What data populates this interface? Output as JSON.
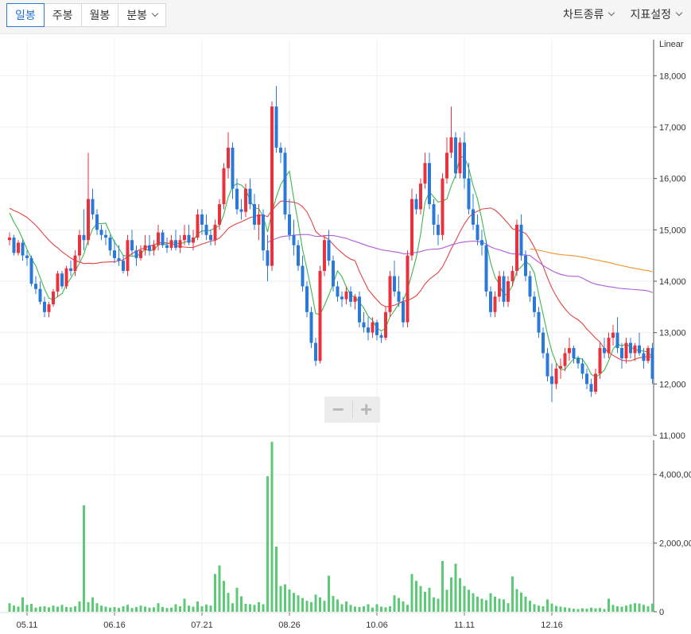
{
  "toolbar": {
    "periods": [
      {
        "label": "일봉",
        "active": true
      },
      {
        "label": "주봉",
        "active": false
      },
      {
        "label": "월봉",
        "active": false
      },
      {
        "label": "분봉",
        "active": false
      }
    ],
    "chart_type_label": "차트종류",
    "indicator_label": "지표설정"
  },
  "zoom": {
    "out_glyph": "−",
    "in_glyph": "+"
  },
  "chart_data": {
    "type": "candlestick",
    "scale_label": "Linear",
    "x_ticks": [
      "05.11",
      "06.16",
      "07.21",
      "08.26",
      "10.06",
      "11.11",
      "12.16"
    ],
    "price_axis": {
      "min": 11000,
      "max": 18700,
      "ticks": [
        11000,
        12000,
        13000,
        14000,
        15000,
        16000,
        17000,
        18000
      ],
      "tick_labels": [
        "11,000",
        "12,000",
        "13,000",
        "14,000",
        "15,000",
        "16,000",
        "17,000",
        "18,000"
      ]
    },
    "volume_axis": {
      "min": 0,
      "max": 5000000,
      "ticks": [
        0,
        2000000,
        4000000
      ],
      "tick_labels": [
        "0",
        "2,000,00",
        "4,000,00"
      ]
    },
    "colors": {
      "up": "#e8333f",
      "down": "#2a78d8",
      "volume": "#5cc977",
      "ma5": "#3db84f",
      "ma20": "#e04545",
      "ma60": "#b35ad9",
      "ma120": "#f0932b"
    },
    "candles": [
      [
        14800,
        14950,
        14700,
        14850
      ],
      [
        14850,
        14900,
        14500,
        14550
      ],
      [
        14550,
        14800,
        14500,
        14750
      ],
      [
        14750,
        14800,
        14400,
        14500
      ],
      [
        14500,
        14600,
        14300,
        14450
      ],
      [
        14450,
        14500,
        13900,
        13950
      ],
      [
        13950,
        14100,
        13750,
        13850
      ],
      [
        13850,
        14000,
        13550,
        13600
      ],
      [
        13600,
        13700,
        13300,
        13400
      ],
      [
        13400,
        13600,
        13300,
        13550
      ],
      [
        13550,
        13850,
        13500,
        13800
      ],
      [
        13800,
        14200,
        13700,
        14150
      ],
      [
        14150,
        14200,
        13850,
        13900
      ],
      [
        13900,
        14300,
        13850,
        14250
      ],
      [
        14250,
        14400,
        14100,
        14200
      ],
      [
        14200,
        14600,
        14100,
        14500
      ],
      [
        14500,
        15000,
        14400,
        14900
      ],
      [
        14900,
        15400,
        14600,
        14800
      ],
      [
        14800,
        16500,
        14700,
        15600
      ],
      [
        15600,
        15800,
        15200,
        15300
      ],
      [
        15300,
        15400,
        14900,
        15000
      ],
      [
        15000,
        15100,
        14800,
        14900
      ],
      [
        14900,
        15000,
        14700,
        14850
      ],
      [
        14850,
        14900,
        14500,
        14600
      ],
      [
        14600,
        14800,
        14350,
        14450
      ],
      [
        14450,
        14700,
        14300,
        14400
      ],
      [
        14400,
        14500,
        14150,
        14200
      ],
      [
        14200,
        14900,
        14100,
        14800
      ],
      [
        14800,
        15000,
        14500,
        14600
      ],
      [
        14600,
        14700,
        14300,
        14450
      ],
      [
        14450,
        14700,
        14400,
        14600
      ],
      [
        14600,
        14900,
        14500,
        14700
      ],
      [
        14700,
        14900,
        14500,
        14600
      ],
      [
        14600,
        14800,
        14500,
        14700
      ],
      [
        14700,
        15100,
        14600,
        14950
      ],
      [
        14950,
        15000,
        14650,
        14700
      ],
      [
        14700,
        14850,
        14550,
        14650
      ],
      [
        14650,
        14900,
        14600,
        14800
      ],
      [
        14800,
        15000,
        14600,
        14650
      ],
      [
        14650,
        14900,
        14550,
        14800
      ],
      [
        14800,
        15100,
        14700,
        14900
      ],
      [
        14900,
        15100,
        14700,
        14750
      ],
      [
        14750,
        15000,
        14600,
        14850
      ],
      [
        14850,
        15400,
        14800,
        15300
      ],
      [
        15300,
        15400,
        14900,
        15100
      ],
      [
        15100,
        15300,
        14800,
        14900
      ],
      [
        14900,
        15000,
        14700,
        14800
      ],
      [
        14800,
        15200,
        14700,
        15100
      ],
      [
        15100,
        15600,
        15000,
        15500
      ],
      [
        15500,
        16300,
        15400,
        16200
      ],
      [
        16200,
        16900,
        16000,
        16600
      ],
      [
        16600,
        16700,
        15600,
        15800
      ],
      [
        15800,
        16000,
        15300,
        15400
      ],
      [
        15400,
        15600,
        15200,
        15350
      ],
      [
        15350,
        15900,
        15250,
        15800
      ],
      [
        15800,
        16000,
        15400,
        15500
      ],
      [
        15500,
        15700,
        15000,
        15100
      ],
      [
        15100,
        15500,
        14800,
        15300
      ],
      [
        15300,
        15400,
        14400,
        14600
      ],
      [
        14600,
        14900,
        14000,
        14300
      ],
      [
        14300,
        17500,
        14200,
        17400
      ],
      [
        17400,
        17800,
        16500,
        16600
      ],
      [
        16600,
        16700,
        16300,
        16500
      ],
      [
        16500,
        16600,
        15200,
        15300
      ],
      [
        15300,
        15600,
        14800,
        14900
      ],
      [
        14900,
        15200,
        14500,
        14700
      ],
      [
        14700,
        14800,
        14200,
        14300
      ],
      [
        14300,
        14500,
        13800,
        13900
      ],
      [
        13900,
        14000,
        13300,
        13400
      ],
      [
        13400,
        13500,
        12700,
        12800
      ],
      [
        12800,
        12900,
        12350,
        12450
      ],
      [
        12450,
        14300,
        12400,
        14200
      ],
      [
        14200,
        14900,
        14100,
        14800
      ],
      [
        14800,
        15000,
        14300,
        14400
      ],
      [
        14400,
        14500,
        13800,
        13900
      ],
      [
        13900,
        14000,
        13600,
        13700
      ],
      [
        13700,
        13800,
        13500,
        13650
      ],
      [
        13650,
        13900,
        13550,
        13800
      ],
      [
        13800,
        13900,
        13500,
        13600
      ],
      [
        13600,
        13750,
        13450,
        13700
      ],
      [
        13700,
        13800,
        13100,
        13200
      ],
      [
        13200,
        13400,
        13000,
        13100
      ],
      [
        13100,
        13300,
        12850,
        13000
      ],
      [
        13000,
        13300,
        12900,
        13200
      ],
      [
        13200,
        13250,
        12850,
        12950
      ],
      [
        12950,
        13000,
        12800,
        12900
      ],
      [
        12900,
        13500,
        12850,
        13400
      ],
      [
        13400,
        14200,
        13300,
        14100
      ],
      [
        14100,
        14400,
        13700,
        13800
      ],
      [
        13800,
        14100,
        13500,
        13600
      ],
      [
        13600,
        13700,
        13100,
        13200
      ],
      [
        13200,
        14600,
        13100,
        14500
      ],
      [
        14500,
        15800,
        14400,
        15600
      ],
      [
        15600,
        15700,
        15300,
        15400
      ],
      [
        15400,
        16000,
        15300,
        15900
      ],
      [
        15900,
        16500,
        15800,
        16300
      ],
      [
        16300,
        16500,
        15400,
        15500
      ],
      [
        15500,
        15600,
        14900,
        15100
      ],
      [
        15100,
        15300,
        14700,
        14900
      ],
      [
        14900,
        16100,
        14800,
        16000
      ],
      [
        16000,
        16800,
        15900,
        16500
      ],
      [
        16500,
        17400,
        16400,
        16800
      ],
      [
        16800,
        16900,
        16000,
        16100
      ],
      [
        16100,
        16800,
        16000,
        16700
      ],
      [
        16700,
        16900,
        15800,
        16000
      ],
      [
        16000,
        16300,
        15300,
        15400
      ],
      [
        15400,
        15700,
        15000,
        15100
      ],
      [
        15100,
        15300,
        14700,
        14800
      ],
      [
        14800,
        15000,
        14500,
        14700
      ],
      [
        14700,
        14800,
        13700,
        13800
      ],
      [
        13800,
        13900,
        13300,
        13400
      ],
      [
        13400,
        13800,
        13300,
        13700
      ],
      [
        13700,
        14200,
        13600,
        14100
      ],
      [
        14100,
        14200,
        13500,
        13600
      ],
      [
        13600,
        14100,
        13500,
        14000
      ],
      [
        14000,
        14300,
        13900,
        14200
      ],
      [
        14200,
        15200,
        14100,
        15100
      ],
      [
        15100,
        15300,
        14400,
        14500
      ],
      [
        14500,
        14600,
        14000,
        14100
      ],
      [
        14100,
        14200,
        13600,
        13700
      ],
      [
        13700,
        13800,
        13300,
        13400
      ],
      [
        13400,
        13500,
        12900,
        13000
      ],
      [
        13000,
        13100,
        12500,
        12600
      ],
      [
        12600,
        12700,
        12050,
        12150
      ],
      [
        12150,
        12400,
        11650,
        12000
      ],
      [
        12000,
        12400,
        11900,
        12300
      ],
      [
        12300,
        12500,
        12100,
        12350
      ],
      [
        12350,
        12700,
        12250,
        12600
      ],
      [
        12600,
        12900,
        12450,
        12700
      ],
      [
        12700,
        12750,
        12400,
        12500
      ],
      [
        12500,
        12550,
        12300,
        12400
      ],
      [
        12400,
        12500,
        12100,
        12200
      ],
      [
        12200,
        12300,
        11900,
        12000
      ],
      [
        12000,
        12100,
        11750,
        11850
      ],
      [
        11850,
        12300,
        11800,
        12200
      ],
      [
        12200,
        12800,
        12100,
        12700
      ],
      [
        12700,
        12900,
        12500,
        12600
      ],
      [
        12600,
        13000,
        12500,
        12900
      ],
      [
        12900,
        13150,
        12750,
        13000
      ],
      [
        13000,
        13300,
        12600,
        12700
      ],
      [
        12700,
        12800,
        12300,
        12500
      ],
      [
        12500,
        12900,
        12400,
        12800
      ],
      [
        12800,
        12900,
        12500,
        12600
      ],
      [
        12600,
        12800,
        12450,
        12750
      ],
      [
        12750,
        13000,
        12550,
        12600
      ],
      [
        12600,
        12700,
        12300,
        12450
      ],
      [
        12450,
        12750,
        12400,
        12700
      ],
      [
        12700,
        12800,
        12000,
        12100
      ]
    ],
    "volume": [
      250000,
      180000,
      150000,
      420000,
      200000,
      230000,
      120000,
      150000,
      160000,
      130000,
      180000,
      150000,
      200000,
      140000,
      130000,
      160000,
      300000,
      3100000,
      280000,
      420000,
      250000,
      180000,
      150000,
      120000,
      140000,
      110000,
      160000,
      200000,
      110000,
      140000,
      180000,
      150000,
      120000,
      130000,
      250000,
      140000,
      110000,
      120000,
      220000,
      160000,
      380000,
      180000,
      150000,
      300000,
      160000,
      210000,
      180000,
      1100000,
      1350000,
      900000,
      550000,
      250000,
      700000,
      450000,
      230000,
      220000,
      200000,
      280000,
      220000,
      3950000,
      4950000,
      1900000,
      750000,
      800000,
      650000,
      550000,
      480000,
      400000,
      320000,
      280000,
      500000,
      420000,
      320000,
      1050000,
      460000,
      360000,
      220000,
      300000,
      200000,
      150000,
      140000,
      160000,
      220000,
      120000,
      220000,
      150000,
      130000,
      160000,
      480000,
      400000,
      300000,
      200000,
      1100000,
      900000,
      750000,
      580000,
      700000,
      420000,
      380000,
      1480000,
      640000,
      1000000,
      1400000,
      980000,
      750000,
      640000,
      540000,
      440000,
      380000,
      340000,
      540000,
      440000,
      380000,
      360000,
      250000,
      1030000,
      660000,
      560000,
      440000,
      320000,
      220000,
      180000,
      160000,
      360000,
      240000,
      170000,
      150000,
      130000,
      110000,
      90000,
      80000,
      100000,
      90000,
      120000,
      100000,
      110000,
      80000,
      380000,
      200000,
      160000,
      150000,
      180000,
      220000,
      250000,
      240000,
      200000,
      160000,
      240000
    ],
    "ma_series": [
      {
        "key": "ma5",
        "period": 5
      },
      {
        "key": "ma20",
        "period": 20
      },
      {
        "key": "ma60",
        "period": 60
      },
      {
        "key": "ma120",
        "period": 120
      }
    ]
  }
}
